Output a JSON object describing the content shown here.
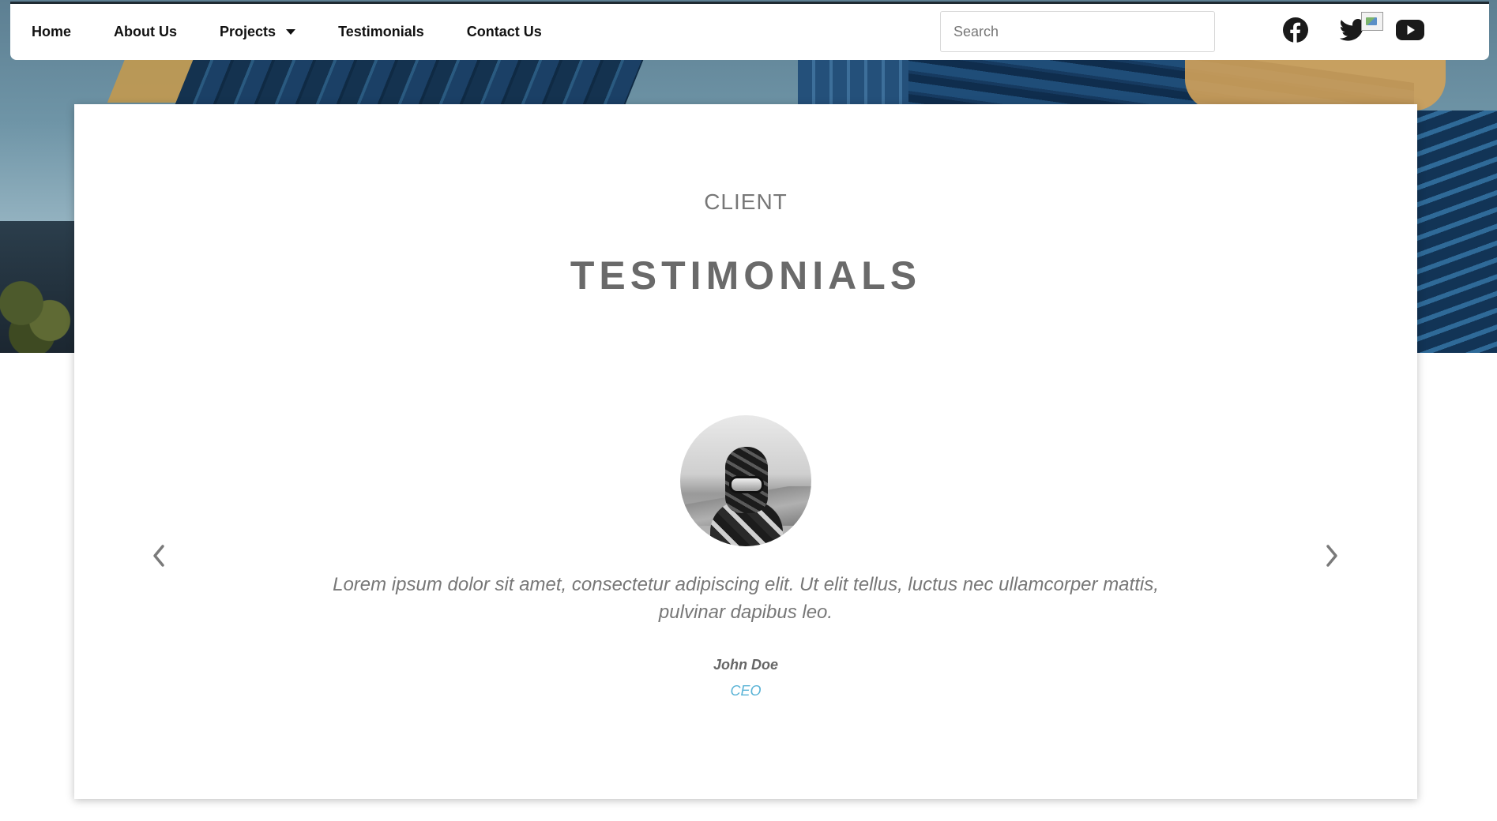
{
  "nav": {
    "items": [
      {
        "label": "Home"
      },
      {
        "label": "About Us"
      },
      {
        "label": "Projects",
        "has_dropdown": true
      },
      {
        "label": "Testimonials"
      },
      {
        "label": "Contact Us"
      }
    ],
    "search": {
      "placeholder": "Search",
      "value": ""
    },
    "social": [
      {
        "name": "facebook-icon"
      },
      {
        "name": "twitter-icon"
      },
      {
        "name": "youtube-icon"
      }
    ]
  },
  "testimonials": {
    "eyebrow": "CLIENT",
    "title": "TESTIMONIALS",
    "quote": "Lorem ipsum dolor sit amet, consectetur adipiscing elit. Ut elit tellus, luctus nec ullamcorper mattis, pulvinar dapibus leo.",
    "author_name": "John Doe",
    "author_title": "CEO"
  },
  "colors": {
    "nav_text": "#111111",
    "heading": "#6a6a6a",
    "accent": "#5ab3d6",
    "body_text": "#777777"
  }
}
